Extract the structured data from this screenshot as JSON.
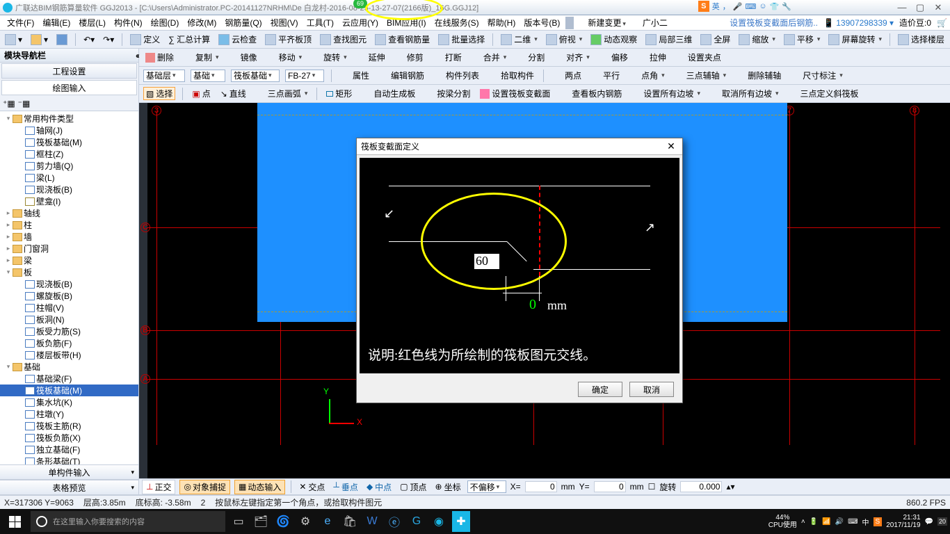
{
  "title": "广联达BIM钢筋算量软件 GGJ2013 - [C:\\Users\\Administrator.PC-20141127NRHM\\De          白龙村-2016-08-25-13-27-07(2166版)_16G.GGJ12]",
  "badge69": "69",
  "sogou_text": "英",
  "winctl": {
    "min": "—",
    "max": "▢",
    "close": "✕"
  },
  "menus": [
    "文件(F)",
    "编辑(E)",
    "楼层(L)",
    "构件(N)",
    "绘图(D)",
    "修改(M)",
    "钢筋量(Q)",
    "视图(V)",
    "工具(T)",
    "云应用(Y)",
    "BIM应用(I)",
    "在线服务(S)",
    "帮助(H)",
    "版本号(B)"
  ],
  "menu_new": "新建变更",
  "menu_user": "广小二",
  "announce": "设置筏板变截面后钢筋..",
  "menu_id": "13907298339",
  "menu_price": "造价豆:0",
  "tb1": {
    "def": "定义",
    "sum": "∑ 汇总计算",
    "cloud": "云检查",
    "flat": "平齐板顶",
    "find": "查找图元",
    "seebar": "查看钢筋量",
    "batch": "批量选择",
    "two": "二维",
    "bird": "俯视",
    "dyn": "动态观察",
    "local3d": "局部三维",
    "full": "全屏",
    "zoom": "缩放",
    "pan": "平移",
    "screen": "屏幕旋转",
    "pickfloor": "选择楼层"
  },
  "tb2": {
    "del": "删除",
    "copy": "复制",
    "mirror": "镜像",
    "move": "移动",
    "rotate": "旋转",
    "extend": "延伸",
    "trim": "修剪",
    "break": "打断",
    "merge": "合并",
    "split": "分割",
    "align": "对齐",
    "offset": "偏移",
    "stretch": "拉伸",
    "setclamp": "设置夹点"
  },
  "tb3": {
    "floor": "基础层",
    "kind": "基础",
    "sub": "筏板基础",
    "code": "FB-27",
    "prop": "属性",
    "editbar": "编辑钢筋",
    "list": "构件列表",
    "pick": "拾取构件",
    "two": "两点",
    "parallel": "平行",
    "ptangle": "点角",
    "three": "三点辅轴",
    "delaux": "删除辅轴",
    "dim": "尺寸标注"
  },
  "tb4": {
    "select": "选择",
    "point": "点",
    "line": "直线",
    "arc": "三点画弧",
    "rect": "矩形",
    "auto": "自动生成板",
    "bybeam": "按梁分割",
    "setsec": "设置筏板变截面",
    "seebar": "查看板内钢筋",
    "setall": "设置所有边坡",
    "cancel": "取消所有边坡",
    "threep": "三点定义斜筏板"
  },
  "leftpanel": {
    "head": "模块导航栏",
    "gcheng": "工程设置",
    "drawin": "绘图输入",
    "single": "单构件输入",
    "preview": "表格预览"
  },
  "tree": [
    {
      "d": 0,
      "e": "▾",
      "t": "常用构件类型",
      "f": "folder"
    },
    {
      "d": 1,
      "e": "",
      "t": "轴网(J)",
      "f": "file"
    },
    {
      "d": 1,
      "e": "",
      "t": "筏板基础(M)",
      "f": "file"
    },
    {
      "d": 1,
      "e": "",
      "t": "框柱(Z)",
      "f": "file"
    },
    {
      "d": 1,
      "e": "",
      "t": "剪力墙(Q)",
      "f": "file"
    },
    {
      "d": 1,
      "e": "",
      "t": "梁(L)",
      "f": "file"
    },
    {
      "d": 1,
      "e": "",
      "t": "现浇板(B)",
      "f": "file"
    },
    {
      "d": 1,
      "e": "",
      "t": "壁龛(I)",
      "f": "y"
    },
    {
      "d": 0,
      "e": "▸",
      "t": "轴线",
      "f": "folder"
    },
    {
      "d": 0,
      "e": "▸",
      "t": "柱",
      "f": "folder"
    },
    {
      "d": 0,
      "e": "▸",
      "t": "墙",
      "f": "folder"
    },
    {
      "d": 0,
      "e": "▸",
      "t": "门窗洞",
      "f": "folder"
    },
    {
      "d": 0,
      "e": "▸",
      "t": "梁",
      "f": "folder"
    },
    {
      "d": 0,
      "e": "▾",
      "t": "板",
      "f": "folder"
    },
    {
      "d": 1,
      "e": "",
      "t": "现浇板(B)",
      "f": "file"
    },
    {
      "d": 1,
      "e": "",
      "t": "螺旋板(B)",
      "f": "file"
    },
    {
      "d": 1,
      "e": "",
      "t": "柱帽(V)",
      "f": "file"
    },
    {
      "d": 1,
      "e": "",
      "t": "板洞(N)",
      "f": "file"
    },
    {
      "d": 1,
      "e": "",
      "t": "板受力筋(S)",
      "f": "file"
    },
    {
      "d": 1,
      "e": "",
      "t": "板负筋(F)",
      "f": "file"
    },
    {
      "d": 1,
      "e": "",
      "t": "楼层板带(H)",
      "f": "file"
    },
    {
      "d": 0,
      "e": "▾",
      "t": "基础",
      "f": "folder"
    },
    {
      "d": 1,
      "e": "",
      "t": "基础梁(F)",
      "f": "file"
    },
    {
      "d": 1,
      "e": "",
      "t": "筏板基础(M)",
      "f": "file",
      "sel": true
    },
    {
      "d": 1,
      "e": "",
      "t": "集水坑(K)",
      "f": "file"
    },
    {
      "d": 1,
      "e": "",
      "t": "柱墩(Y)",
      "f": "file"
    },
    {
      "d": 1,
      "e": "",
      "t": "筏板主筋(R)",
      "f": "file"
    },
    {
      "d": 1,
      "e": "",
      "t": "筏板负筋(X)",
      "f": "file"
    },
    {
      "d": 1,
      "e": "",
      "t": "独立基础(F)",
      "f": "file"
    },
    {
      "d": 1,
      "e": "",
      "t": "条形基础(T)",
      "f": "file"
    }
  ],
  "dialog": {
    "title": "筏板变截面定义",
    "explain": "说明:红色线为所绘制的筏板图元交线。",
    "val": "60",
    "zero": "0",
    "mm": "mm",
    "ok": "确定",
    "cancel": "取消"
  },
  "status_top": {
    "ortho": "正交",
    "snap": "对象捕捉",
    "dyn": "动态输入",
    "cross": "交点",
    "perp": "垂点",
    "mid": "中点",
    "top": "顶点",
    "coord": "坐标",
    "nooffset": "不偏移",
    "x": "X=",
    "y": "Y=",
    "mm": "mm",
    "rot": "旋转",
    "xval": "0",
    "yval": "0",
    "rotval": "0.000"
  },
  "status_bot": {
    "xy": "X=317306 Y=9063",
    "fh": "层高:3.85m",
    "bh": "底标高: -3.58m",
    "two": "2",
    "hint": "按鼠标左键指定第一个角点，或拾取构件图元",
    "fps": "860.2 FPS"
  },
  "taskbar": {
    "search": "在这里输入你要搜索的内容",
    "cpu": "44%",
    "cpulabel": "CPU使用",
    "time": "21:31",
    "date": "2017/11/19",
    "ime": "中",
    "b20": "20"
  }
}
